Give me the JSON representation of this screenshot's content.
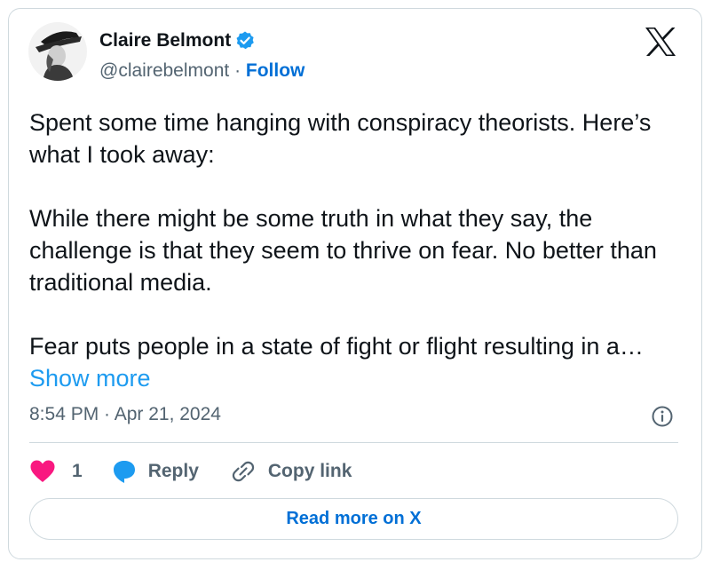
{
  "author": {
    "name": "Claire Belmont",
    "handle": "@clairebelmont",
    "separator": "·",
    "follow_label": "Follow"
  },
  "tweet": {
    "text": "Spent some time hanging with conspiracy theorists. Here’s what I took away:\n\nWhile there might be some truth in what they say, the challenge is that they seem to thrive on fear. No better than traditional media.\n\nFear puts people in a state of fight or flight resulting in a…",
    "show_more_label": "Show more",
    "timestamp": "8:54 PM · Apr 21, 2024"
  },
  "actions": {
    "like_count": "1",
    "reply_label": "Reply",
    "copy_link_label": "Copy link"
  },
  "read_more_label": "Read more on X",
  "icons": {
    "avatar": "avatar-hat-figure",
    "verified": "verified-badge-icon",
    "logo": "x-logo-icon",
    "info": "info-icon",
    "like": "heart-icon",
    "reply": "speech-bubble-icon",
    "copy_link": "link-icon"
  },
  "colors": {
    "accent": "#1d9bf0",
    "link": "#006fd6",
    "like": "#f91880",
    "text": "#0f1419",
    "muted": "#536471",
    "border": "#cfd9de"
  }
}
